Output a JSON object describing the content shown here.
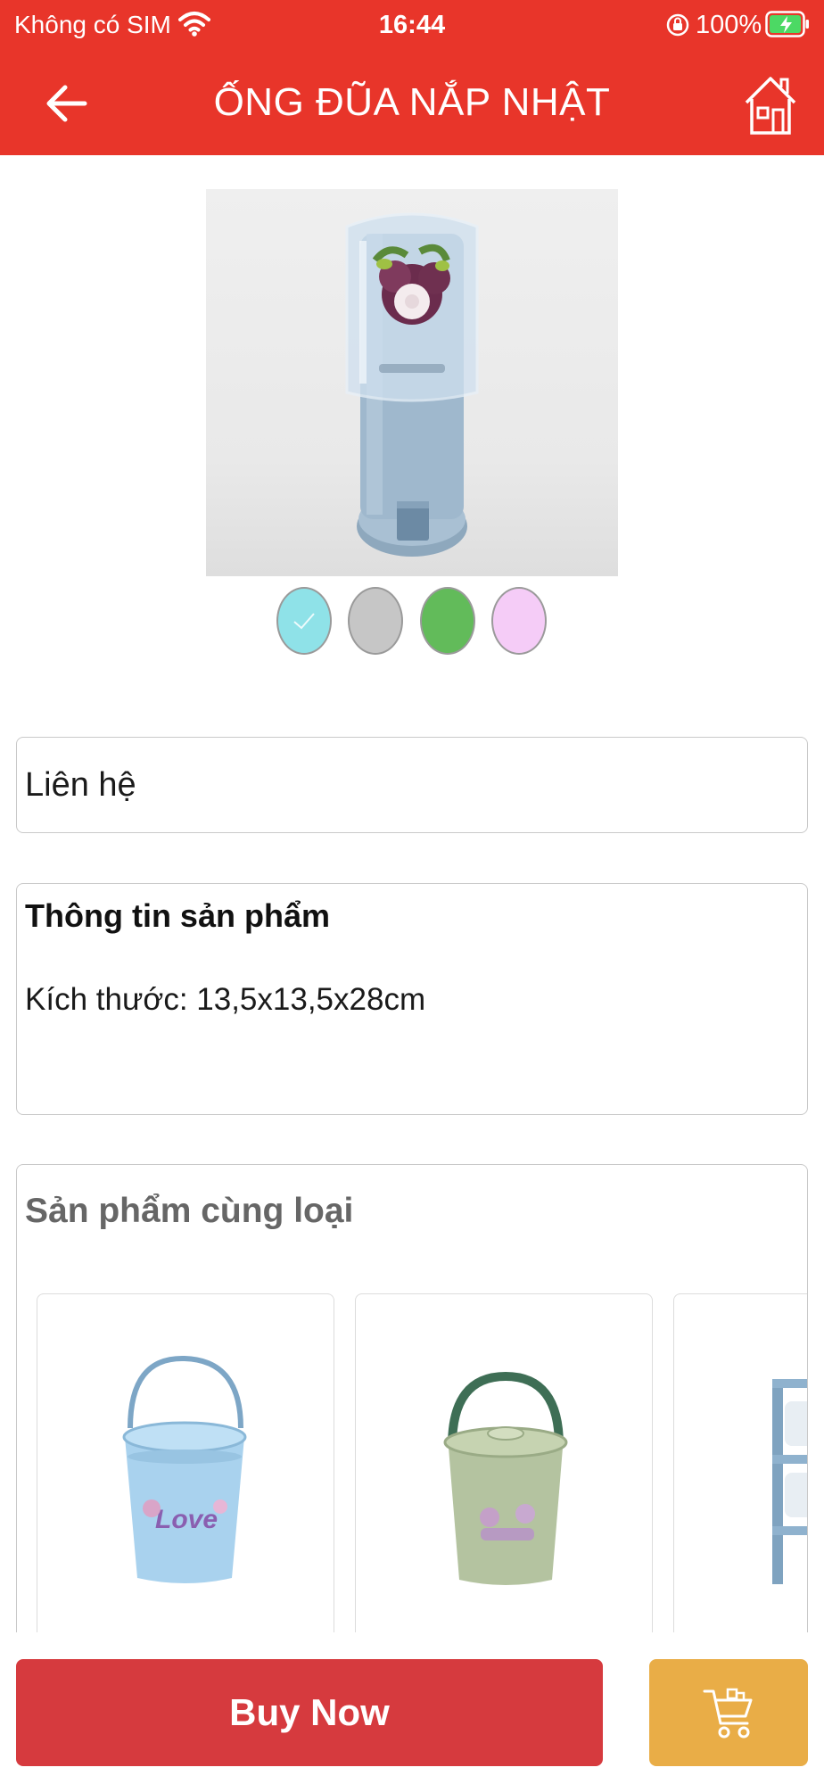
{
  "status_bar": {
    "carrier": "Không có SIM",
    "time": "16:44",
    "battery": "100%",
    "icons": [
      "wifi-icon",
      "lock-rotation-icon",
      "battery-charging-icon"
    ]
  },
  "nav": {
    "title": "ỐNG ĐŨA NẮP NHẬT",
    "back_icon": "arrow-left-icon",
    "home_icon": "home-icon"
  },
  "product": {
    "image": "chopstick-holder-product-image",
    "colors": [
      {
        "name": "light-blue",
        "hex": "#8fe2e8",
        "selected": true
      },
      {
        "name": "gray",
        "hex": "#c6c6c6",
        "selected": false
      },
      {
        "name": "green",
        "hex": "#62bb5a",
        "selected": false
      },
      {
        "name": "pink",
        "hex": "#f5ccf7",
        "selected": false
      }
    ]
  },
  "price": {
    "label": "Liên hệ"
  },
  "info": {
    "title": "Thông tin sản phẩm",
    "size": "Kích thước: 13,5x13,5x28cm"
  },
  "related": {
    "title": "Sản phẩm cùng loại",
    "items": [
      {
        "image": "blue-bucket-image"
      },
      {
        "image": "green-bucket-image"
      },
      {
        "image": "shelf-image"
      }
    ]
  },
  "actions": {
    "buy_now_label": "Buy Now",
    "cart_icon": "shopping-cart-icon"
  },
  "colors": {
    "header_red": "#e8352a",
    "buy_now_red": "#d63a3e",
    "cart_orange": "#e9ad47"
  }
}
